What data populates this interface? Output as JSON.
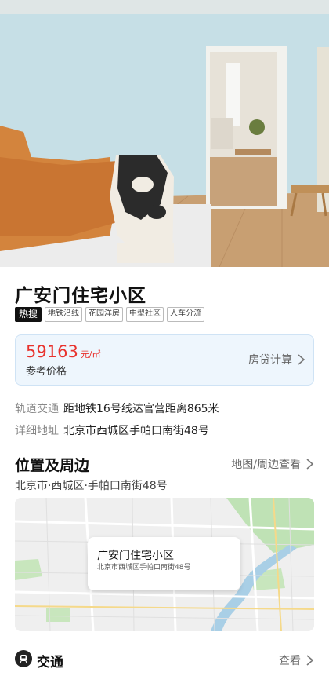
{
  "listing": {
    "title": "广安门住宅小区",
    "hot_tag": "热搜",
    "tags": [
      "地铁沿线",
      "花园洋房",
      "中型社区",
      "人车分流"
    ]
  },
  "price": {
    "value": "59163",
    "unit": "元/㎡",
    "label": "参考价格",
    "loan_calc": "房贷计算"
  },
  "info": {
    "transit_label": "轨道交通",
    "transit_value": "距地铁16号线达官营距离865米",
    "address_label": "详细地址",
    "address_value": "北京市西城区手帕口南街48号"
  },
  "location": {
    "title": "位置及周边",
    "link": "地图/周边查看",
    "path": "北京市·西城区·手帕口南街48号",
    "map_card_title": "广安门住宅小区",
    "map_card_sub": "北京市西城区手帕口南街48号"
  },
  "transport": {
    "title": "交通",
    "link": "查看"
  },
  "colors": {
    "price_red": "#e8322d",
    "card_bg": "#eef6fd"
  },
  "icons": {
    "chevron": "chevron-right-icon",
    "transport": "metro-icon"
  }
}
